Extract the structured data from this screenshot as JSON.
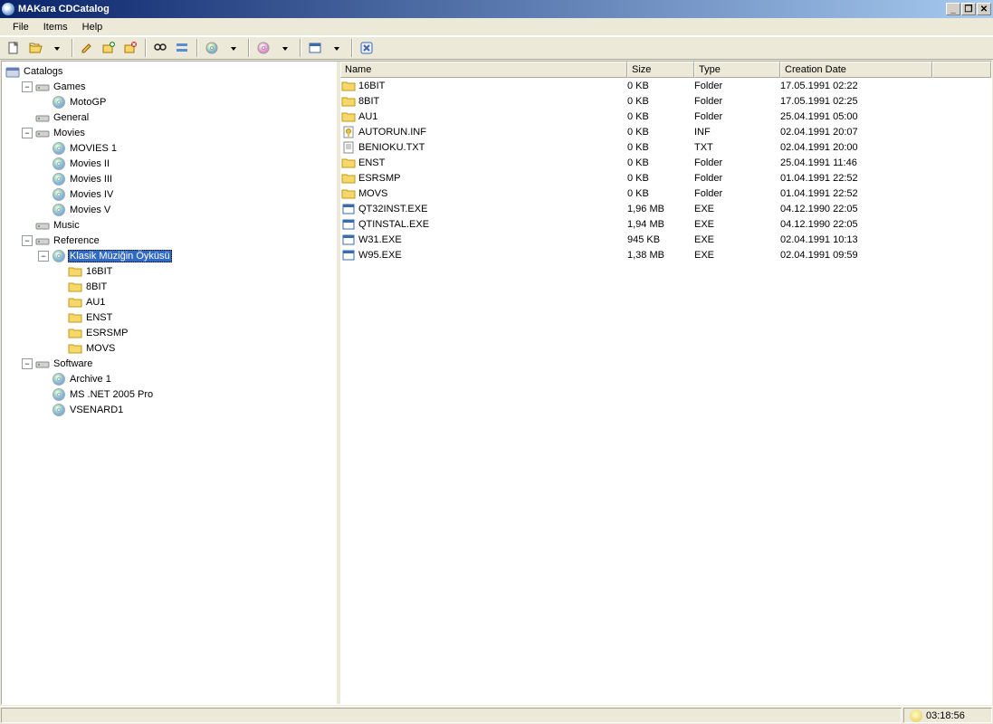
{
  "title": "MAKara CDCatalog",
  "menu": {
    "file": "File",
    "items": "Items",
    "help": "Help"
  },
  "toolbar": [
    "new",
    "open",
    "",
    "edit",
    "add",
    "remove",
    "",
    "find",
    "toggle",
    "",
    "disc1",
    "",
    "disc2",
    "",
    "view",
    "",
    "close"
  ],
  "tree_root": "Catalogs",
  "tree": [
    {
      "label": "Games",
      "icon": "drive",
      "exp": "-",
      "children": [
        {
          "label": "MotoGP",
          "icon": "cd"
        }
      ]
    },
    {
      "label": "General",
      "icon": "drive",
      "exp": "none"
    },
    {
      "label": "Movies",
      "icon": "drive",
      "exp": "-",
      "children": [
        {
          "label": "MOVIES 1",
          "icon": "cd"
        },
        {
          "label": "Movies II",
          "icon": "cd"
        },
        {
          "label": "Movies III",
          "icon": "cd"
        },
        {
          "label": "Movies IV",
          "icon": "cd"
        },
        {
          "label": "Movies V",
          "icon": "cd"
        }
      ]
    },
    {
      "label": "Music",
      "icon": "drive",
      "exp": "none"
    },
    {
      "label": "Reference",
      "icon": "drive",
      "exp": "-",
      "children": [
        {
          "label": "Klasik Müziğin Öyküsü",
          "icon": "cd",
          "exp": "-",
          "selected": true,
          "children": [
            {
              "label": "16BIT",
              "icon": "folder"
            },
            {
              "label": "8BIT",
              "icon": "folder"
            },
            {
              "label": "AU1",
              "icon": "folder"
            },
            {
              "label": "ENST",
              "icon": "folder"
            },
            {
              "label": "ESRSMP",
              "icon": "folder"
            },
            {
              "label": "MOVS",
              "icon": "folder"
            }
          ]
        }
      ]
    },
    {
      "label": "Software",
      "icon": "drive",
      "exp": "-",
      "children": [
        {
          "label": "Archive 1",
          "icon": "cd"
        },
        {
          "label": "MS .NET 2005 Pro",
          "icon": "cd"
        },
        {
          "label": "VSENARD1",
          "icon": "cd"
        }
      ]
    }
  ],
  "columns": {
    "name": "Name",
    "size": "Size",
    "type": "Type",
    "date": "Creation Date"
  },
  "files": [
    {
      "name": "16BIT",
      "size": "0 KB",
      "type": "Folder",
      "date": "17.05.1991 02:22",
      "icon": "folder"
    },
    {
      "name": "8BIT",
      "size": "0 KB",
      "type": "Folder",
      "date": "17.05.1991 02:25",
      "icon": "folder"
    },
    {
      "name": "AU1",
      "size": "0 KB",
      "type": "Folder",
      "date": "25.04.1991 05:00",
      "icon": "folder"
    },
    {
      "name": "AUTORUN.INF",
      "size": "0 KB",
      "type": "INF",
      "date": "02.04.1991 20:07",
      "icon": "inf"
    },
    {
      "name": "BENIOKU.TXT",
      "size": "0 KB",
      "type": "TXT",
      "date": "02.04.1991 20:00",
      "icon": "txt"
    },
    {
      "name": "ENST",
      "size": "0 KB",
      "type": "Folder",
      "date": "25.04.1991 11:46",
      "icon": "folder"
    },
    {
      "name": "ESRSMP",
      "size": "0 KB",
      "type": "Folder",
      "date": "01.04.1991 22:52",
      "icon": "folder"
    },
    {
      "name": "MOVS",
      "size": "0 KB",
      "type": "Folder",
      "date": "01.04.1991 22:52",
      "icon": "folder"
    },
    {
      "name": "QT32INST.EXE",
      "size": "1,96 MB",
      "type": "EXE",
      "date": "04.12.1990 22:05",
      "icon": "exe"
    },
    {
      "name": "QTINSTAL.EXE",
      "size": "1,94 MB",
      "type": "EXE",
      "date": "04.12.1990 22:05",
      "icon": "exe"
    },
    {
      "name": "W31.EXE",
      "size": "945 KB",
      "type": "EXE",
      "date": "02.04.1991 10:13",
      "icon": "exe"
    },
    {
      "name": "W95.EXE",
      "size": "1,38 MB",
      "type": "EXE",
      "date": "02.04.1991 09:59",
      "icon": "exe"
    }
  ],
  "status_time": "03:18:56"
}
